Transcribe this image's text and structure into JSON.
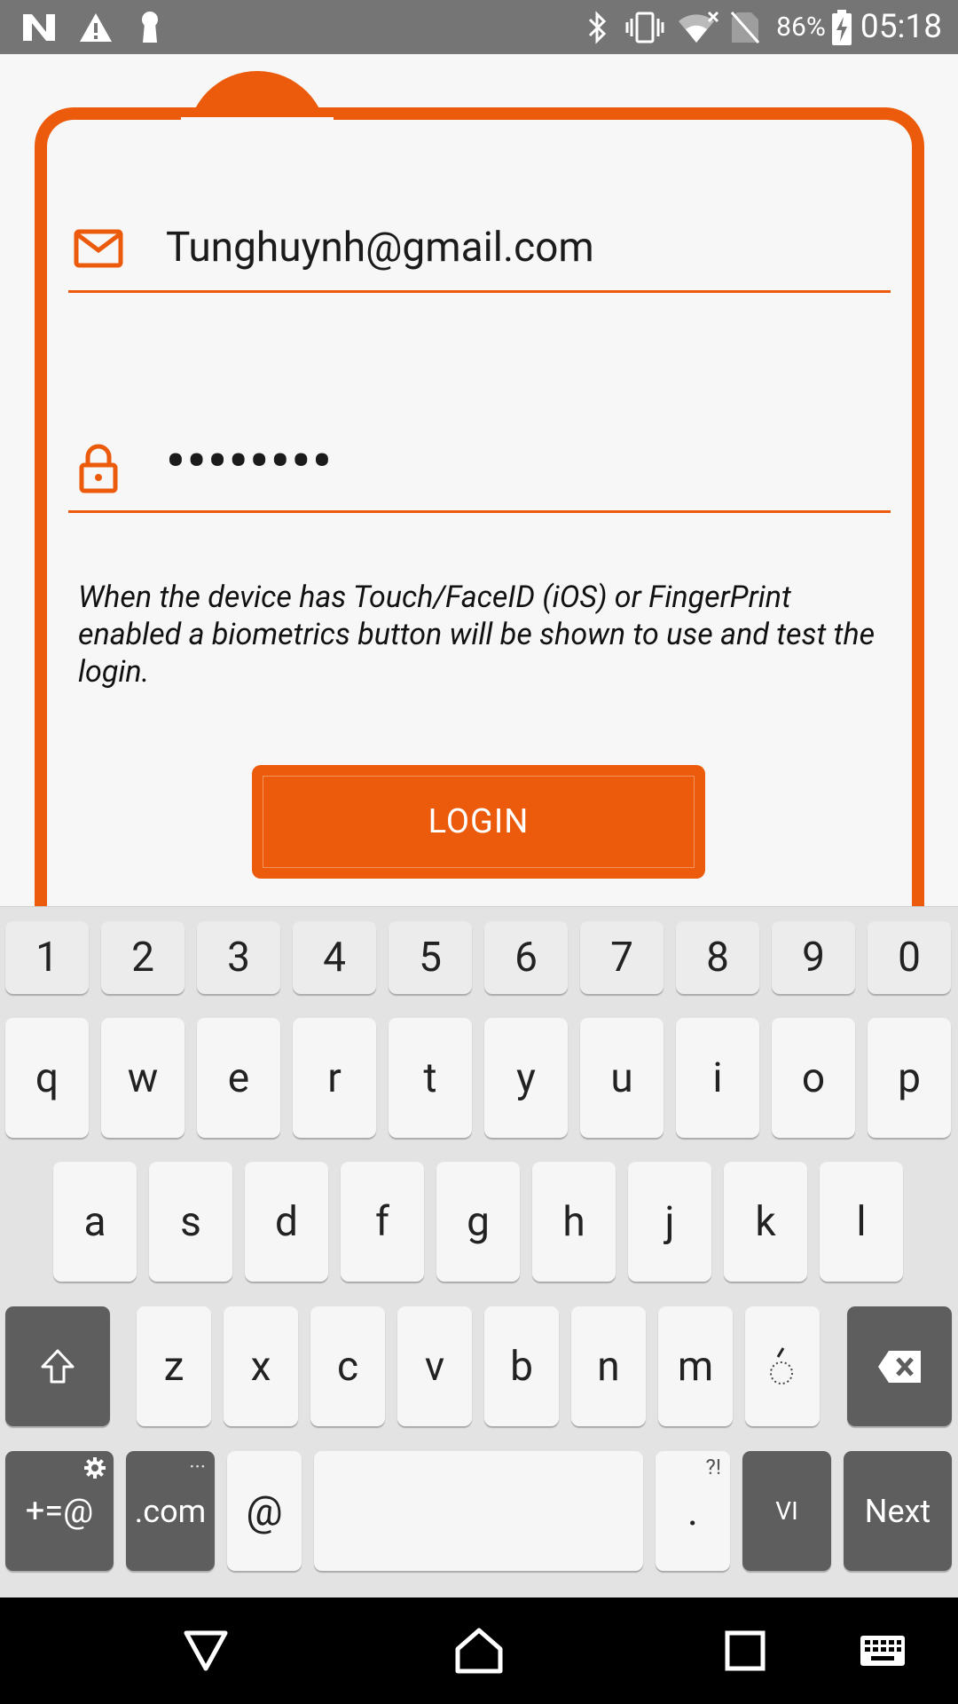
{
  "status_bar": {
    "battery_percent": "86%",
    "time": "05:18",
    "left_icons": [
      "n-notification-icon",
      "warning-icon",
      "keyhole-icon"
    ],
    "right_icons": [
      "bluetooth-icon",
      "vibrate-icon",
      "wifi-icon",
      "no-sim-icon",
      "battery-charging-icon"
    ]
  },
  "form": {
    "email": {
      "value": "Tunghuynh@gmail.com",
      "icon": "mail-icon"
    },
    "password": {
      "value": "••••••••",
      "icon": "lock-icon"
    },
    "hint": "When the device has Touch/FaceID (iOS) or FingerPrint enabled a biometrics button will be shown to use and test the login.",
    "login_label": "LOGIN"
  },
  "colors": {
    "accent": "#eb5b0b",
    "status_bar": "#757575",
    "keyboard_bg": "#e3e3e3",
    "dark_key": "#5e5e5e"
  },
  "keyboard": {
    "number_row": [
      "1",
      "2",
      "3",
      "4",
      "5",
      "6",
      "7",
      "8",
      "9",
      "0"
    ],
    "row1": [
      "q",
      "w",
      "e",
      "r",
      "t",
      "y",
      "u",
      "i",
      "o",
      "p"
    ],
    "row2": [
      "a",
      "s",
      "d",
      "f",
      "g",
      "h",
      "j",
      "k",
      "l"
    ],
    "row3": [
      "z",
      "x",
      "c",
      "v",
      "b",
      "n",
      "m",
      "́"
    ],
    "symbols_label": "+=@",
    "dotcom_label": ".com",
    "dotcom_hint": "···",
    "at_label": "@",
    "period_label": ".",
    "period_hint": "?!",
    "language_label": "VI",
    "next_label": "Next"
  },
  "nav_bar": {
    "buttons": [
      "back-icon",
      "home-icon",
      "recents-icon",
      "keyboard-icon"
    ]
  }
}
